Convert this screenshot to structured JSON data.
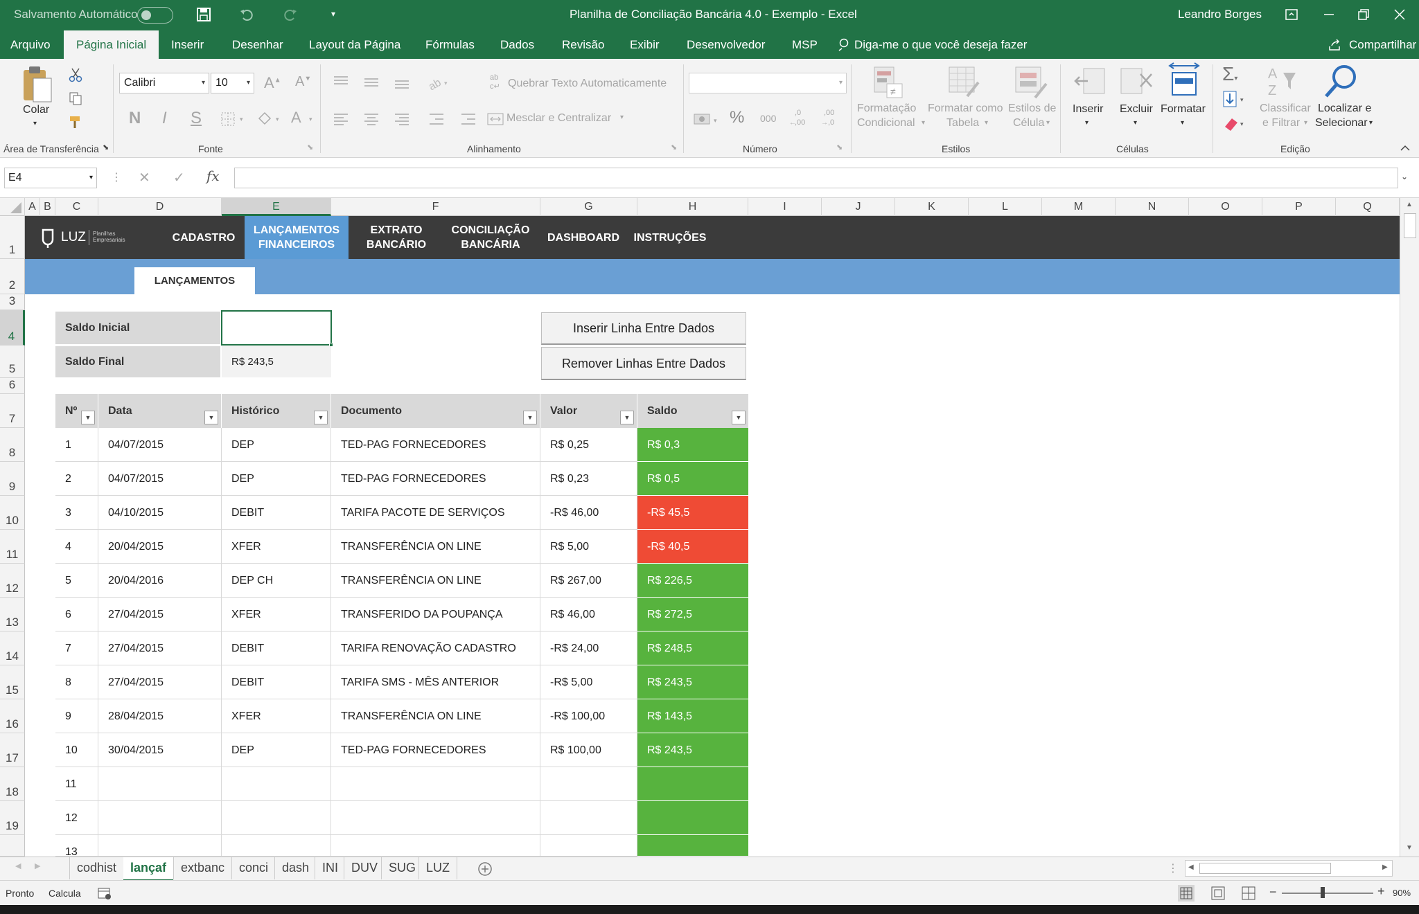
{
  "window": {
    "autosave_label": "Salvamento Automático",
    "title": "Planilha de Conciliação Bancária 4.0 - Exemplo  -  Excel",
    "user": "Leandro Borges"
  },
  "ribbon_tabs": [
    "Arquivo",
    "Página Inicial",
    "Inserir",
    "Desenhar",
    "Layout da Página",
    "Fórmulas",
    "Dados",
    "Revisão",
    "Exibir",
    "Desenvolvedor",
    "MSP"
  ],
  "tell_me": "Diga-me o que você deseja fazer",
  "share": "Compartilhar",
  "ribbon": {
    "paste": "Colar",
    "clipboard_group": "Área de Transferência",
    "font_name": "Calibri",
    "font_size": "10",
    "bold": "N",
    "italic": "I",
    "underline": "S",
    "font_group": "Fonte",
    "wrap_text": "Quebrar Texto Automaticamente",
    "merge_center": "Mesclar e Centralizar",
    "alignment_group": "Alinhamento",
    "number_format": "",
    "percent": "%",
    "thousands": "000",
    "dec_inc": ",0\n,00",
    "dec_dec": ",00\n,0",
    "number_group": "Número",
    "cond_format_1": "Formatação",
    "cond_format_2": "Condicional",
    "format_table_1": "Formatar como",
    "format_table_2": "Tabela",
    "cell_styles_1": "Estilos de",
    "cell_styles_2": "Célula",
    "styles_group": "Estilos",
    "insert": "Inserir",
    "delete": "Excluir",
    "format": "Formatar",
    "cells_group": "Células",
    "sort_1": "Classificar",
    "sort_2": "e Filtrar",
    "find_1": "Localizar e",
    "find_2": "Selecionar",
    "editing_group": "Edição"
  },
  "formula_bar": {
    "name_box": "E4",
    "fx": "fx",
    "value": ""
  },
  "columns": [
    "A",
    "B",
    "C",
    "D",
    "E",
    "F",
    "G",
    "H",
    "I",
    "J",
    "K",
    "L",
    "M",
    "N",
    "O",
    "P",
    "Q"
  ],
  "rows": [
    "1",
    "2",
    "3",
    "4",
    "5",
    "6",
    "7",
    "8",
    "9",
    "10",
    "11",
    "12",
    "13",
    "14",
    "15",
    "16",
    "17",
    "18",
    "19"
  ],
  "sheet_nav": {
    "logo": "LUZ",
    "logo_sub_1": "Planilhas",
    "logo_sub_2": "Empresariais",
    "items": [
      {
        "label1": "CADASTRO",
        "label2": ""
      },
      {
        "label1": "LANÇAMENTOS",
        "label2": "FINANCEIROS"
      },
      {
        "label1": "EXTRATO",
        "label2": "BANCÁRIO"
      },
      {
        "label1": "CONCILIAÇÃO",
        "label2": "BANCÁRIA"
      },
      {
        "label1": "DASHBOARD",
        "label2": ""
      },
      {
        "label1": "INSTRUÇÕES",
        "label2": ""
      }
    ],
    "subtab": "LANÇAMENTOS"
  },
  "summary": {
    "saldo_inicial_label": "Saldo Inicial",
    "saldo_inicial_value": "",
    "saldo_final_label": "Saldo Final",
    "saldo_final_value": "R$ 243,5"
  },
  "buttons": {
    "insert_row": "Inserir Linha Entre Dados",
    "remove_rows": "Remover Linhas Entre Dados"
  },
  "table": {
    "headers": [
      "Nº",
      "Data",
      "Histórico",
      "Documento",
      "Valor",
      "Saldo"
    ],
    "rows": [
      {
        "n": "1",
        "data": "04/07/2015",
        "hist": "DEP",
        "doc": "TED-PAG FORNECEDORES",
        "valor": "R$ 0,25",
        "saldo": "R$ 0,3",
        "status": "pos"
      },
      {
        "n": "2",
        "data": "04/07/2015",
        "hist": "DEP",
        "doc": "TED-PAG FORNECEDORES",
        "valor": "R$ 0,23",
        "saldo": "R$ 0,5",
        "status": "pos"
      },
      {
        "n": "3",
        "data": "04/10/2015",
        "hist": "DEBIT",
        "doc": "TARIFA PACOTE DE SERVIÇOS",
        "valor": "-R$ 46,00",
        "saldo": "-R$ 45,5",
        "status": "neg"
      },
      {
        "n": "4",
        "data": "20/04/2015",
        "hist": "XFER",
        "doc": "TRANSFERÊNCIA ON LINE",
        "valor": "R$ 5,00",
        "saldo": "-R$ 40,5",
        "status": "neg"
      },
      {
        "n": "5",
        "data": "20/04/2016",
        "hist": "DEP CH",
        "doc": "TRANSFERÊNCIA ON LINE",
        "valor": "R$ 267,00",
        "saldo": "R$ 226,5",
        "status": "pos"
      },
      {
        "n": "6",
        "data": "27/04/2015",
        "hist": "XFER",
        "doc": "TRANSFERIDO DA POUPANÇA",
        "valor": "R$ 46,00",
        "saldo": "R$ 272,5",
        "status": "pos"
      },
      {
        "n": "7",
        "data": "27/04/2015",
        "hist": "DEBIT",
        "doc": "TARIFA RENOVAÇÃO CADASTRO",
        "valor": "-R$ 24,00",
        "saldo": "R$ 248,5",
        "status": "pos"
      },
      {
        "n": "8",
        "data": "27/04/2015",
        "hist": "DEBIT",
        "doc": "TARIFA SMS - MÊS ANTERIOR",
        "valor": "-R$ 5,00",
        "saldo": "R$ 243,5",
        "status": "pos"
      },
      {
        "n": "9",
        "data": "28/04/2015",
        "hist": "XFER",
        "doc": "TRANSFERÊNCIA ON LINE",
        "valor": "-R$ 100,00",
        "saldo": "R$ 143,5",
        "status": "pos"
      },
      {
        "n": "10",
        "data": "30/04/2015",
        "hist": "DEP",
        "doc": "TED-PAG FORNECEDORES",
        "valor": "R$ 100,00",
        "saldo": "R$ 243,5",
        "status": "pos"
      },
      {
        "n": "11",
        "data": "",
        "hist": "",
        "doc": "",
        "valor": "",
        "saldo": "",
        "status": "pos"
      },
      {
        "n": "12",
        "data": "",
        "hist": "",
        "doc": "",
        "valor": "",
        "saldo": "",
        "status": "pos"
      },
      {
        "n": "13",
        "data": "",
        "hist": "",
        "doc": "",
        "valor": "",
        "saldo": "",
        "status": "pos"
      }
    ]
  },
  "sheet_tabs": [
    "codhist",
    "lançaf",
    "extbanc",
    "conci",
    "dash",
    "INI",
    "DUV",
    "SUG",
    "LUZ"
  ],
  "active_sheet": "lançaf",
  "status_bar": {
    "ready": "Pronto",
    "calc": "Calcula",
    "zoom": "90%"
  },
  "colors": {
    "excel_green": "#217346",
    "saldo_positive": "#57b33e",
    "saldo_negative": "#ef4b35",
    "nav_dark": "#3b3b3b",
    "nav_active": "#5b9bd5",
    "sub_bar": "#6a9fd4"
  }
}
